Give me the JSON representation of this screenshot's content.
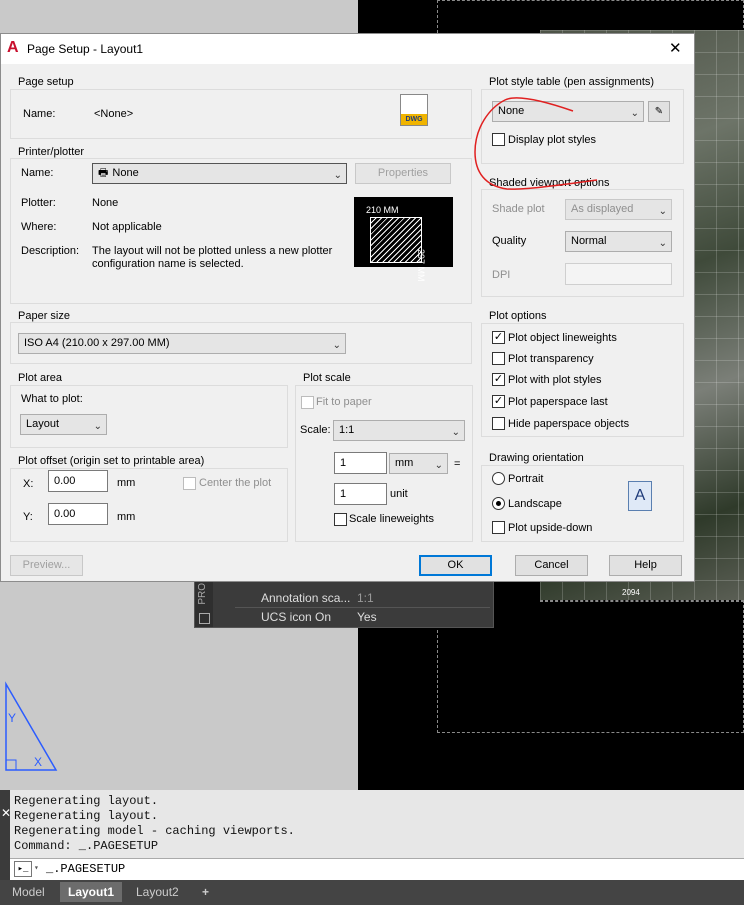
{
  "dialog": {
    "title": "Page Setup - Layout1",
    "close_glyph": "✕",
    "page_setup": {
      "group": "Page setup",
      "name_label": "Name:",
      "name_value": "<None>",
      "icon_text": "DWG"
    },
    "printer": {
      "group": "Printer/plotter",
      "name_label": "Name:",
      "name_value": "None",
      "properties_button": "Properties",
      "plotter_label": "Plotter:",
      "plotter_value": "None",
      "where_label": "Where:",
      "where_value": "Not applicable",
      "description_label": "Description:",
      "description_value": "The layout will not be plotted unless a new plotter configuration name is selected.",
      "preview_width": "210 MM",
      "preview_height": "297 MM"
    },
    "paper_size": {
      "group": "Paper size",
      "value": "ISO A4 (210.00 x 297.00 MM)"
    },
    "plot_area": {
      "group": "Plot area",
      "what_label": "What to plot:",
      "what_value": "Layout"
    },
    "plot_offset": {
      "group": "Plot offset (origin set to printable area)",
      "x_label": "X:",
      "x_value": "0.00",
      "x_unit": "mm",
      "y_label": "Y:",
      "y_value": "0.00",
      "y_unit": "mm",
      "center_label": "Center the plot"
    },
    "plot_scale": {
      "group": "Plot scale",
      "fit_label": "Fit to paper",
      "scale_label": "Scale:",
      "scale_value": "1:1",
      "value1": "1",
      "unit1": "mm",
      "equals": "=",
      "value2": "1",
      "unit2": "unit",
      "lineweights_label": "Scale lineweights"
    },
    "plot_style": {
      "group": "Plot style table (pen assignments)",
      "value": "None",
      "display_label": "Display plot styles"
    },
    "shaded": {
      "group": "Shaded viewport options",
      "shade_label": "Shade plot",
      "shade_value": "As displayed",
      "quality_label": "Quality",
      "quality_value": "Normal",
      "dpi_label": "DPI"
    },
    "plot_options": {
      "group": "Plot options",
      "items": [
        {
          "label": "Plot object lineweights",
          "checked": true
        },
        {
          "label": "Plot transparency",
          "checked": false
        },
        {
          "label": "Plot with plot styles",
          "checked": true
        },
        {
          "label": "Plot paperspace last",
          "checked": true
        },
        {
          "label": "Hide paperspace objects",
          "checked": false
        }
      ]
    },
    "orientation": {
      "group": "Drawing orientation",
      "portrait": "Portrait",
      "landscape": "Landscape",
      "upside_down": "Plot upside-down",
      "icon_letter": "A"
    },
    "buttons": {
      "preview": "Preview...",
      "ok": "OK",
      "cancel": "Cancel",
      "help": "Help"
    }
  },
  "properties_palette": {
    "side_label": "PRO",
    "rows": [
      {
        "name": "Annotation sca...",
        "value": "1:1"
      },
      {
        "name": "UCS icon On",
        "value": "Yes"
      }
    ]
  },
  "viewport_label": "2094",
  "command": {
    "history": [
      "Regenerating layout.",
      "Regenerating layout.",
      "Regenerating model - caching viewports.",
      "Command: _.PAGESETUP"
    ],
    "input": "_.PAGESETUP",
    "prompt_icon": "▸_"
  },
  "tabs": [
    "Model",
    "Layout1",
    "Layout2"
  ],
  "add_tab": "+",
  "colors": {
    "active_tab": "#6c6c6c",
    "ok_border": "#0078d7",
    "annotation_red": "#e02020",
    "ucs_blue": "#2b5cff"
  }
}
